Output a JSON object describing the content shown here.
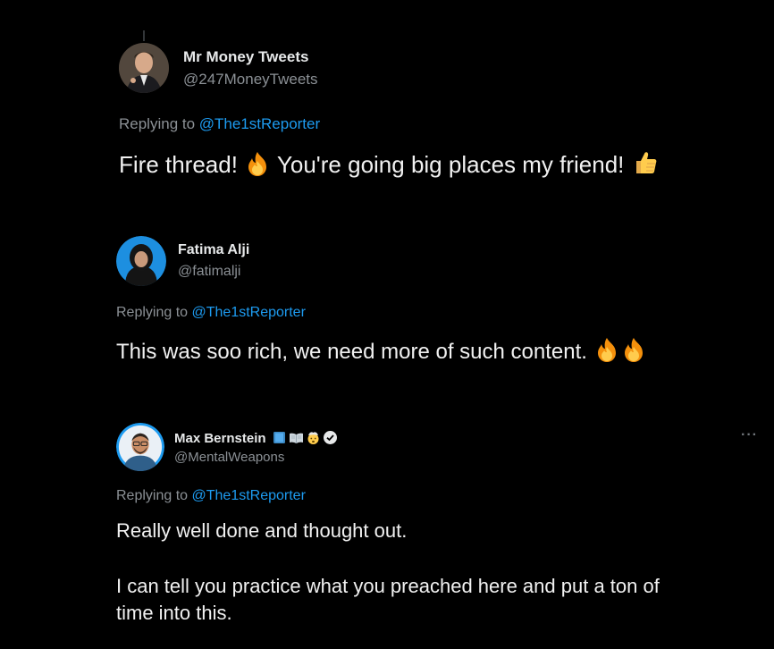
{
  "tweets": [
    {
      "name": "Mr Money Tweets",
      "handle": "@247MoneyTweets",
      "replying_prefix": "Replying to ",
      "replying_to": "@The1stReporter",
      "text_a": "Fire thread! ",
      "text_b": " You're going big places my friend! ",
      "emoji": [
        "fire-emoji",
        "thumbs-up-emoji"
      ]
    },
    {
      "name": "Fatima Alji",
      "handle": "@fatimalji",
      "replying_prefix": "Replying to ",
      "replying_to": "@The1stReporter",
      "text_a": "This was soo rich, we need more of such content. ",
      "emoji": [
        "fire-emoji",
        "fire-emoji"
      ]
    },
    {
      "name": "Max Bernstein",
      "handle": "@MentalWeapons",
      "replying_prefix": "Replying to ",
      "replying_to": "@The1stReporter",
      "line1": "Really well done and thought out.",
      "line2": "I can tell you practice what you preached here and put a ton of",
      "line3": "time into this.",
      "name_badges": [
        "blue-book-emoji",
        "open-book-emoji",
        "exploding-head-emoji",
        "verified-badge-icon"
      ],
      "more": "···"
    }
  ],
  "colors": {
    "background": "#000000",
    "text": "#e7e9ea",
    "muted": "#8b9095",
    "link": "#1d9bf0"
  }
}
